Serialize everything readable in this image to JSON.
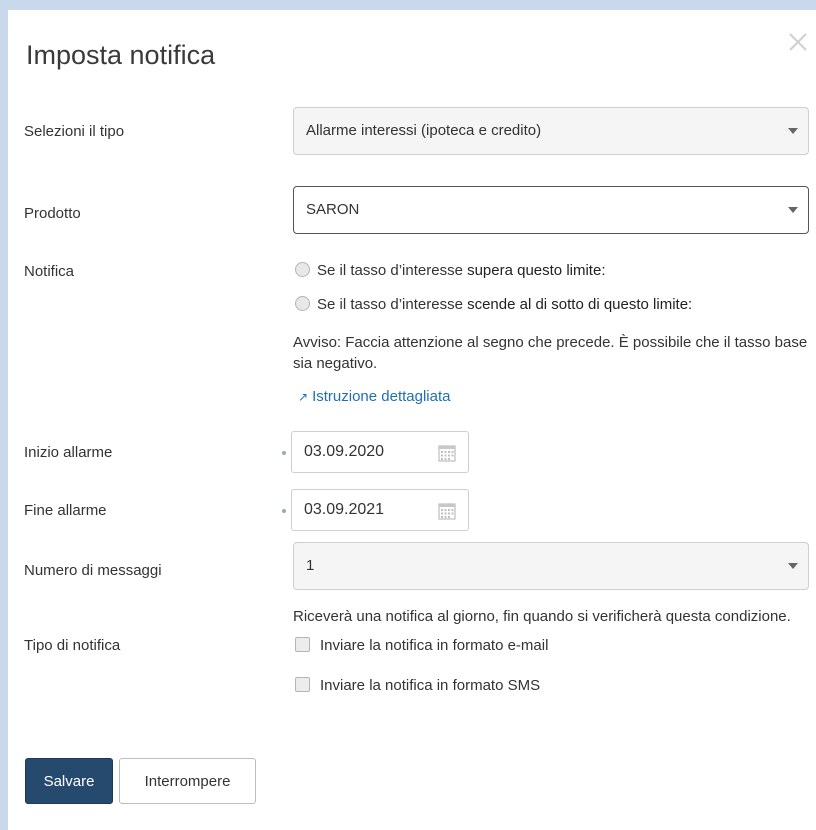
{
  "dialog": {
    "title": "Imposta notifica"
  },
  "fields": {
    "type": {
      "label": "Selezioni il tipo",
      "value": "Allarme interessi (ipoteca e credito)"
    },
    "product": {
      "label": "Prodotto",
      "value": "SARON"
    },
    "notification": {
      "label": "Notifica",
      "options": [
        {
          "prefix": "Se il tasso d’interesse ",
          "emphasis": "supera questo limite:"
        },
        {
          "prefix": "Se il tasso d’interesse ",
          "emphasis": "scende al di sotto di questo limite:"
        }
      ],
      "warning": "Avviso: Faccia attenzione al segno che precede. È possibile che il tasso base sia negativo.",
      "link": "Istruzione dettagliata"
    },
    "alarm_start": {
      "label": "Inizio allarme",
      "value": "03.09.2020"
    },
    "alarm_end": {
      "label": "Fine allarme",
      "value": "03.09.2021"
    },
    "message_count": {
      "label": "Numero di messaggi",
      "value": "1",
      "hint": "Riceverà una notifica al giorno, fin quando si verificherà questa condizione."
    },
    "notification_type": {
      "label": "Tipo di notifica",
      "options": [
        "Inviare la notifica in formato e-mail",
        "Inviare la notifica in formato SMS"
      ]
    }
  },
  "buttons": {
    "save": "Salvare",
    "cancel": "Interrompere"
  },
  "colors": {
    "primary": "#264a6e",
    "link": "#1f6fb2",
    "backdrop": "#c9d8eb"
  }
}
